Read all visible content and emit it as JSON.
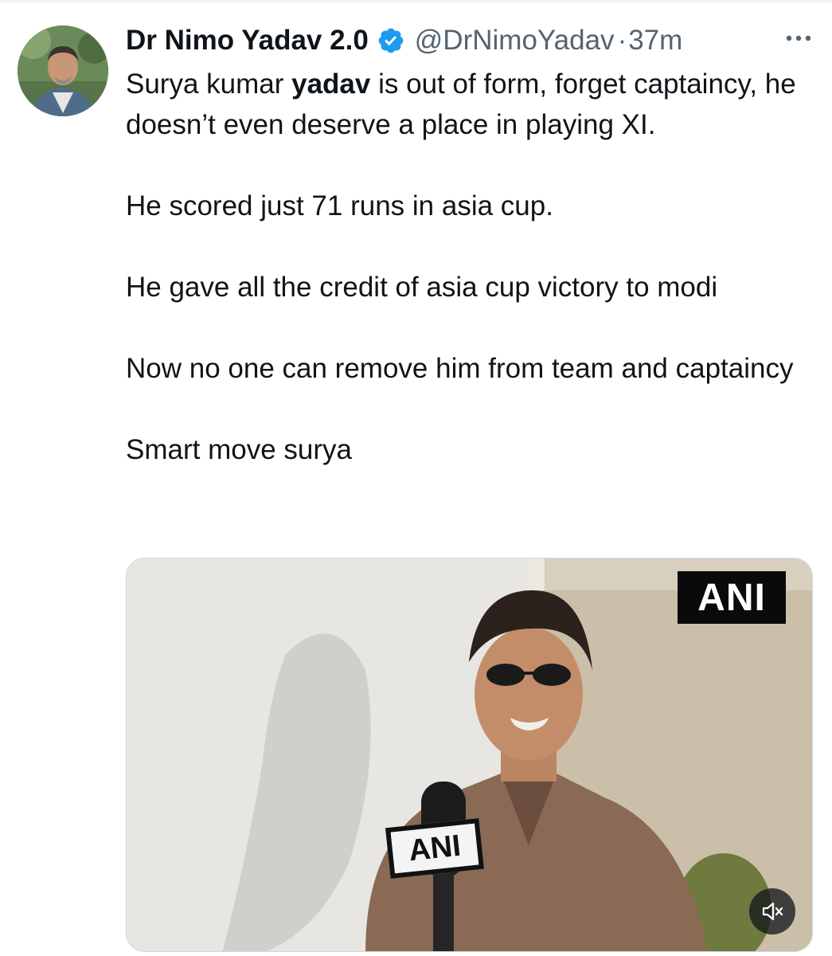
{
  "tweet": {
    "display_name": "Dr Nimo Yadav 2.0",
    "handle": "@DrNimoYadav",
    "separator": "·",
    "timestamp": "37m",
    "verified": true,
    "more_icon": "more-horizontal-icon",
    "text": {
      "line1_pre": "Surya kumar ",
      "line1_bold": "yadav",
      "line1_post": " is out of form, forget captaincy, he doesn’t even deserve a place in playing XI.",
      "para2": "He scored just 71 runs in asia cup.",
      "para3": "He gave all the credit of asia cup victory to modi",
      "para4": "Now no one can remove him from team and captaincy",
      "para5": "Smart move surya"
    },
    "media": {
      "watermark": "ANI",
      "mic_flag": "ANI",
      "mute_icon": "volume-muted-icon"
    }
  },
  "colors": {
    "text_primary": "#0f1419",
    "text_secondary": "#536471",
    "verified_blue": "#1d9bf0",
    "border": "#cfd9de"
  }
}
